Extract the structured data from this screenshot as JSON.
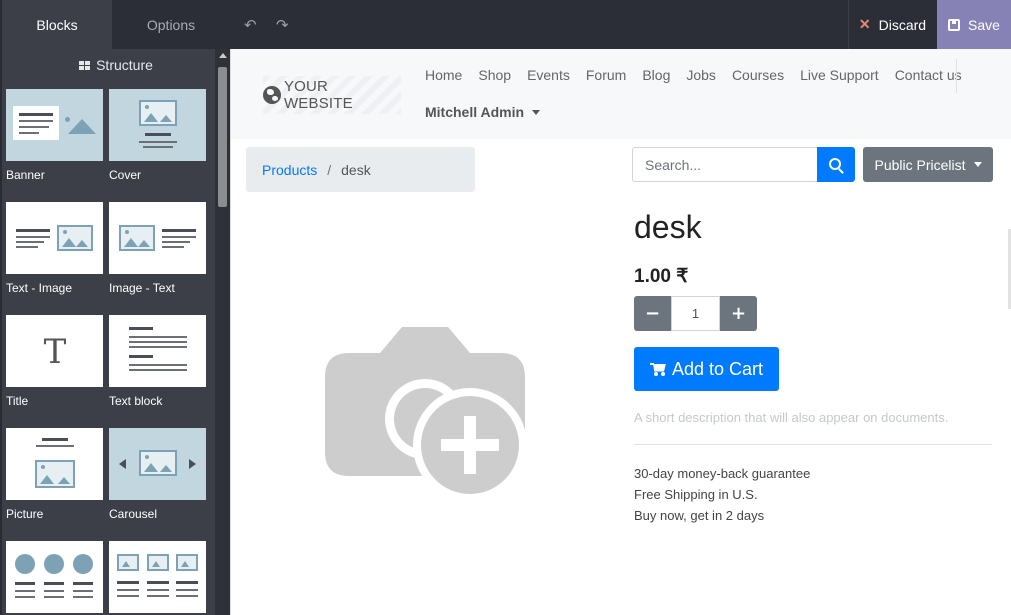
{
  "sidebar": {
    "tabs": [
      {
        "label": "Blocks",
        "active": true
      },
      {
        "label": "Options",
        "active": false
      }
    ],
    "section_title": "Structure",
    "blocks": [
      {
        "label": "Banner",
        "icon": "banner-thumbnail"
      },
      {
        "label": "Cover",
        "icon": "cover-thumbnail"
      },
      {
        "label": "Text - Image",
        "icon": "text-image-thumbnail"
      },
      {
        "label": "Image - Text",
        "icon": "image-text-thumbnail"
      },
      {
        "label": "Title",
        "icon": "title-thumbnail"
      },
      {
        "label": "Text block",
        "icon": "text-block-thumbnail"
      },
      {
        "label": "Picture",
        "icon": "picture-thumbnail"
      },
      {
        "label": "Carousel",
        "icon": "carousel-thumbnail"
      },
      {
        "label": "",
        "icon": "features-thumbnail"
      },
      {
        "label": "",
        "icon": "three-columns-thumbnail"
      }
    ]
  },
  "topbar": {
    "discard_label": "Discard",
    "save_label": "Save",
    "save_color": "#8782b6"
  },
  "site": {
    "logo_text": "YOUR WEBSITE",
    "nav": [
      "Home",
      "Shop",
      "Events",
      "Forum",
      "Blog",
      "Jobs",
      "Courses",
      "Live Support",
      "Contact us"
    ],
    "user": "Mitchell Admin",
    "breadcrumb": {
      "parent": "Products",
      "separator": "/",
      "current": "desk"
    },
    "search": {
      "placeholder": "Search..."
    },
    "pricelist_label": "Public Pricelist",
    "product": {
      "name": "desk",
      "price": "1.00 ₹",
      "quantity": "1",
      "add_to_cart_label": "Add to Cart",
      "short_description": "A short description that will also appear on documents.",
      "terms": [
        "30-day money-back guarantee",
        "Free Shipping in U.S.",
        "Buy now, get in 2 days"
      ]
    },
    "colors": {
      "primary": "#007bff",
      "secondary": "#6c757d"
    }
  }
}
